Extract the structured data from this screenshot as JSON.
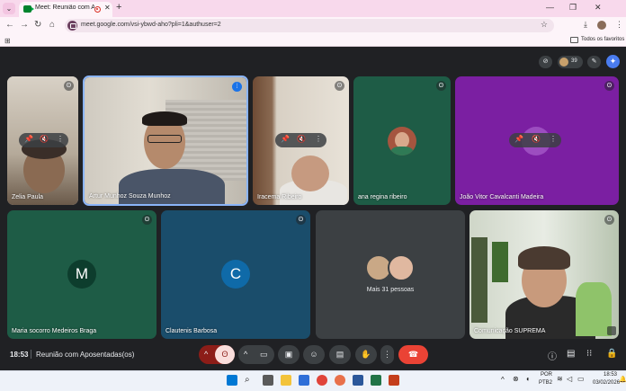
{
  "browser": {
    "tab_title": "Meet: Reunião com Aposen",
    "url": "meet.google.com/vsi-ybwd-aho?pli=1&authuser=2",
    "bookmarks_folder": "Todos os favoritos"
  },
  "meet": {
    "participants_count": "39",
    "time": "18:53",
    "meeting_title": "Reunião com Aposentadas(os)"
  },
  "tiles": [
    {
      "name": "Zelia Paula"
    },
    {
      "name": "Artur Munhoz Souza Munhoz"
    },
    {
      "name": "Iracema Ribeiro"
    },
    {
      "name": "ana regina ribeiro"
    },
    {
      "name": "João Vitor Cavalcanti Madeira"
    },
    {
      "name": "Maria socorro Medeiros Braga",
      "initial": "M"
    },
    {
      "name": "Clautenis Barbosa",
      "initial": "C"
    },
    {
      "name": "Mais 31 pessoas"
    },
    {
      "name": "Comunicação SUPREMA"
    }
  ],
  "taskbar": {
    "lang_top": "POR",
    "lang_bottom": "PTB2",
    "clock_time": "18:53",
    "clock_date": "03/02/2026"
  },
  "colors": {
    "meet_bg": "#202124",
    "tile_green": "#1e5c46",
    "tile_teal": "#1a4d6b",
    "tile_purple": "#7b1fa2",
    "hangup": "#ea4335",
    "mic_off_bg": "#f9dedc"
  }
}
